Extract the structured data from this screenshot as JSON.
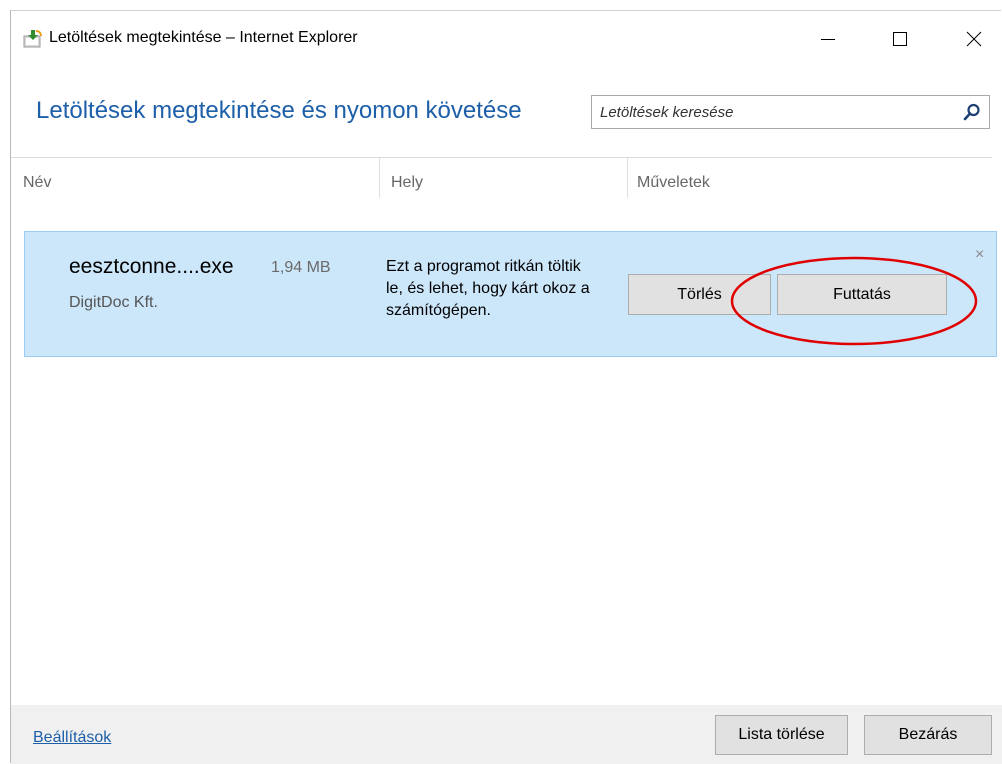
{
  "window": {
    "title": "Letöltések megtekintése – Internet Explorer",
    "icon": "ie-downloads-icon"
  },
  "header": {
    "heading": "Letöltések megtekintése és nyomon követése",
    "search_placeholder": "Letöltések keresése"
  },
  "columns": [
    "Név",
    "Hely",
    "Műveletek"
  ],
  "download": {
    "name": "eesztconne....exe",
    "size": "1,94 MB",
    "publisher": "DigitDoc Kft.",
    "warning": "Ezt a programot ritkán töltik le, és lehet, hogy kárt okoz a számítógépen.",
    "delete_label": "Törlés",
    "run_label": "Futtatás",
    "dismiss_glyph": "×"
  },
  "footer": {
    "settings_label": "Beállítások",
    "clear_list_label": "Lista törlése",
    "close_label": "Bezárás"
  },
  "colors": {
    "accent": "#1d5fa8",
    "item_background": "#cce6fa",
    "highlight": "#e00000"
  }
}
